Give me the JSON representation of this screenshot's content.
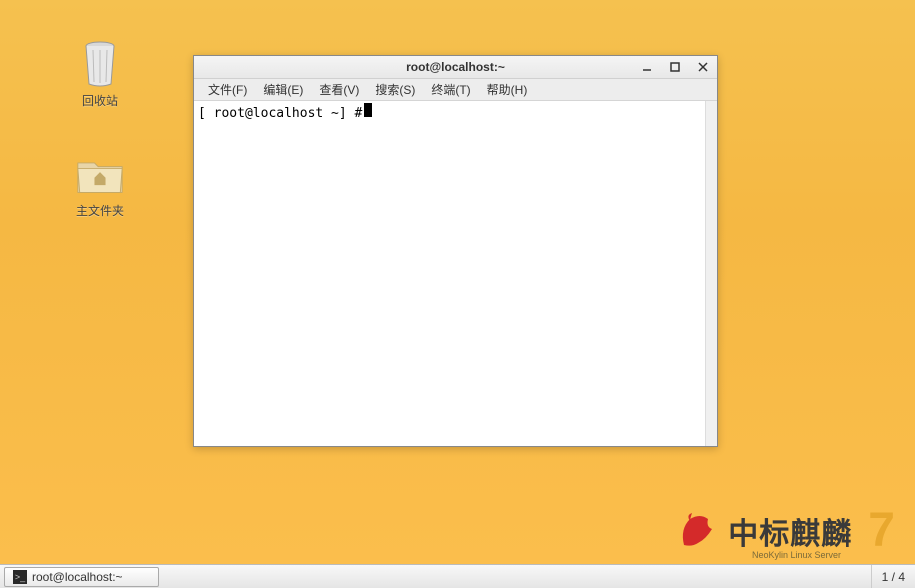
{
  "desktop": {
    "icons": {
      "trash": {
        "label": "回收站"
      },
      "home": {
        "label": "主文件夹"
      }
    },
    "branding": {
      "text": "中标麒麟",
      "sub": "NeoKylin Linux Server",
      "version": "7"
    }
  },
  "terminal": {
    "title": "root@localhost:~",
    "menu": {
      "file": "文件(F)",
      "edit": "编辑(E)",
      "view": "查看(V)",
      "search": "搜索(S)",
      "terminal": "终端(T)",
      "help": "帮助(H)"
    },
    "prompt": "[ root@localhost ~] # "
  },
  "taskbar": {
    "task_label": "root@localhost:~",
    "workspace": "1 / 4"
  }
}
